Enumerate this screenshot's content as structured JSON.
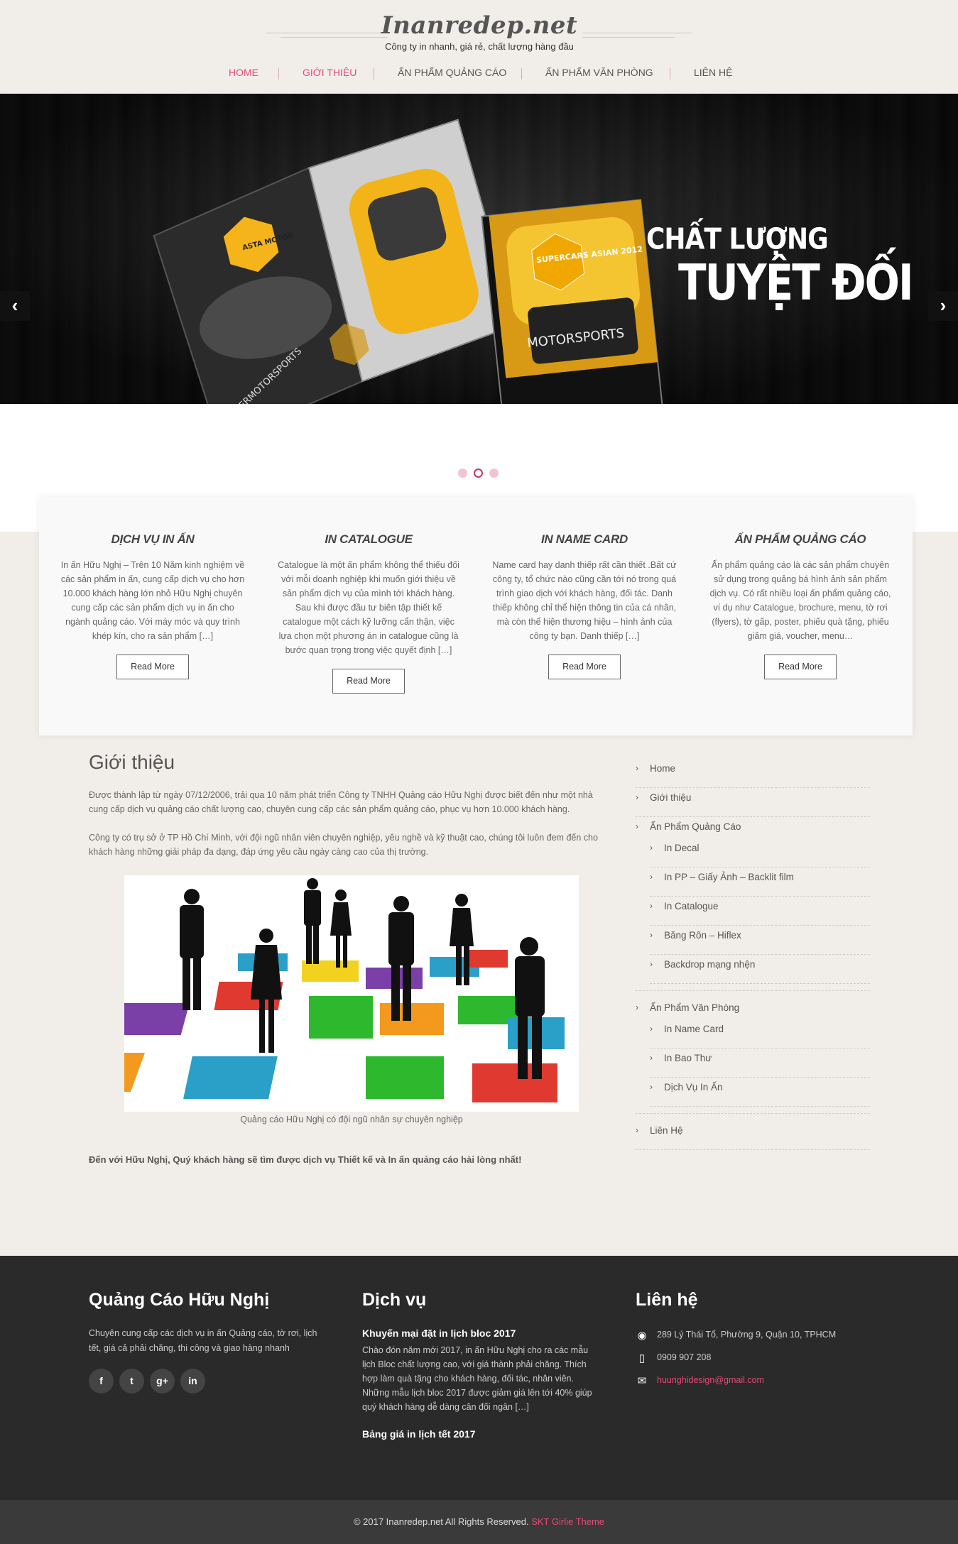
{
  "site": {
    "logo": "Inanredep.net",
    "tagline": "Công ty in nhanh, giá rẻ, chất lượng hàng đầu"
  },
  "nav": [
    {
      "label": "HOME",
      "active": true
    },
    {
      "label": "GIỚI THIỆU",
      "active": false
    },
    {
      "label": "ẤN PHẨM QUẢNG CÁO",
      "active": false
    },
    {
      "label": "ẤN PHẨM VĂN PHÒNG",
      "active": false
    },
    {
      "label": "LIÊN HỆ",
      "active": false
    }
  ],
  "slider": {
    "caption_line1": "CHẤT LƯỢNG",
    "caption_line2": "TUYỆT ĐỐI",
    "prev_icon": "chevron-left-icon",
    "next_icon": "chevron-right-icon",
    "magazine_texts": [
      "ASTA MOTOR",
      "SUPERCARS ASIAN 2012",
      "MOTORSPORTS",
      "SUPERMOTORSPORTS"
    ],
    "active_slide": 2,
    "slide_count": 3
  },
  "services": [
    {
      "title": "DỊCH VỤ IN ẤN",
      "text": "In ấn Hữu Nghị – Trên 10 Năm kinh nghiệm về các sản phẩm in ấn, cung cấp dịch vụ cho hơn 10.000 khách hàng lớn nhỏ Hữu Nghị chuyên cung cấp các sản phẩm dịch vụ in ấn cho ngành quảng cáo. Với máy móc và quy trình khép kín, cho ra sản phẩm […]",
      "button": "Read More"
    },
    {
      "title": "IN CATALOGUE",
      "text": "Catalogue là một ấn phẩm không thể thiếu đối với mỗi doanh nghiệp khi muốn giới thiệu về sản phẩm dịch vụ của mình tới khách hàng. Sau khi được đầu tư biên tập thiết kế catalogue một cách kỹ lưỡng cẩn thận, việc lựa chọn một phương án in catalogue cũng là bước quan trọng trong việc quyết định […]",
      "button": "Read More"
    },
    {
      "title": "IN NAME CARD",
      "text": "Name card hay danh thiếp rất cần thiết .Bất cứ công ty, tổ chức nào cũng cần tới nó trong quá trình giao dịch với khách hàng, đối tác. Danh thiếp không chỉ thể hiện thông tin của cá nhân, mà còn thể hiện thương hiệu – hình ảnh của công ty bạn. Danh thiếp […]",
      "button": "Read More"
    },
    {
      "title": "ẤN PHẨM QUẢNG CÁO",
      "text": "Ấn phẩm quảng cáo là các sản phẩm chuyên sử dụng trong quảng bá hình ảnh sản phẩm dịch vụ. Có rất nhiều loại ấn phẩm quảng cáo, ví dụ như Catalogue, brochure, menu, tờ rơi (flyers), tờ gấp, poster, phiếu quà tặng, phiếu giảm giá, voucher, menu…",
      "button": "Read More"
    }
  ],
  "main": {
    "title": "Giới thiệu",
    "para1": "Được thành lập từ ngày 07/12/2006, trải qua 10 năm phát triển Công ty TNHH Quảng cáo Hữu Nghị được biết đến như một nhà cung cấp dịch vụ quảng cáo chất lượng cao, chuyên cung cấp các sản phẩm quảng cáo, phục vụ hơn 10.000 khách hàng.",
    "para2": "Công ty có trụ sở ở TP Hồ Chí Minh, với đội ngũ nhân viên chuyên nghiệp, yêu nghề và kỹ thuật cao, chúng tôi luôn đem đến cho khách hàng những giải pháp đa dạng, đáp ứng yêu cầu ngày càng cao của thị trường.",
    "caption": "Quảng cáo Hữu Nghị có đội ngũ nhân sự chuyên nghiệp",
    "closing": "Đến với Hữu Nghị, Quý khách hàng sẽ tìm được dịch vụ Thiết kế và In ấn quảng cáo hài lòng nhất!"
  },
  "sidebar": {
    "home": "Home",
    "about": "Giới thiệu",
    "ads_group": "Ấn Phẩm Quảng Cáo",
    "ads": [
      "In Decal",
      "In PP – Giấy Ảnh – Backlit film",
      "In Catalogue",
      "Băng Rôn – Hiflex",
      "Backdrop mạng nhện"
    ],
    "office_group": "Ấn Phẩm Văn Phòng",
    "office": [
      "In Name Card",
      "In Bao Thư",
      "Dịch Vụ In Ấn"
    ],
    "contact": "Liên Hệ",
    "arrow_icon": "chevron-right-icon"
  },
  "footer": {
    "col1_title": "Quảng Cáo Hữu Nghị",
    "col1_text": "Chuyên cung cấp các dịch vụ in ấn Quảng cáo, tờ rơi, lịch tết, giá cả phải chăng, thi công và giao hàng nhanh",
    "social": [
      "f",
      "t",
      "g+",
      "in"
    ],
    "col2_title": "Dịch vụ",
    "post1_title": "Khuyến mại đặt in lịch bloc 2017",
    "post1_text": "Chào đón năm mới 2017, in ấn Hữu Nghị cho ra các mẫu lịch Bloc chất lượng cao, với giá thành phải chăng. Thích hợp làm quà tặng cho khách hàng, đối tác, nhân viên. Những mẫu lịch bloc 2017 được giảm giá lên tới 40% giúp quý khách hàng dễ dàng cân đối ngân […]",
    "post2_title": "Bảng giá in lịch tết 2017",
    "col3_title": "Liên hệ",
    "address": "289 Lý Thái Tổ, Phường 9, Quận 10, TPHCM",
    "phone": "0909 907 208",
    "email": "huunghidesign@gmail.com",
    "copyright": "© 2017 Inanredep.net All Rights Reserved.",
    "theme": "SKT Girlie Theme"
  },
  "colors": {
    "accent": "#e64b73",
    "header_bg": "#f1eeea",
    "footer_bg": "#2a2a2a"
  }
}
